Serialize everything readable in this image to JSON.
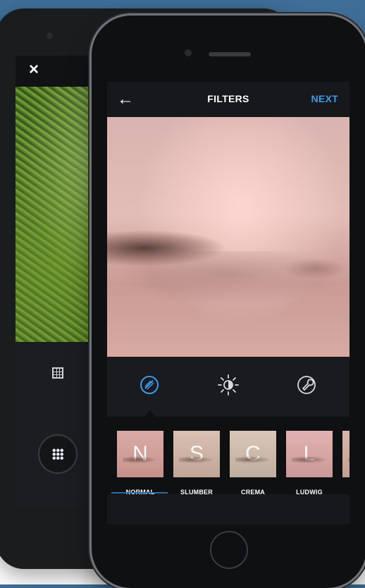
{
  "android": {
    "close_glyph": "×"
  },
  "editor": {
    "title": "FILTERS",
    "next_label": "NEXT",
    "back_glyph": "←"
  },
  "tools": [
    {
      "name": "filter",
      "icon": "filter-icon",
      "active": true
    },
    {
      "name": "lux",
      "icon": "sun-icon",
      "active": false
    },
    {
      "name": "adjust",
      "icon": "wrench-icon",
      "active": false
    }
  ],
  "filters": [
    {
      "letter": "N",
      "label": "NORMAL",
      "selected": true
    },
    {
      "letter": "S",
      "label": "SLUMBER",
      "selected": false
    },
    {
      "letter": "C",
      "label": "CREMA",
      "selected": false
    },
    {
      "letter": "L",
      "label": "LUDWIG",
      "selected": false
    }
  ],
  "colors": {
    "accent": "#3b9bea",
    "screen_bg": "#17181b"
  }
}
